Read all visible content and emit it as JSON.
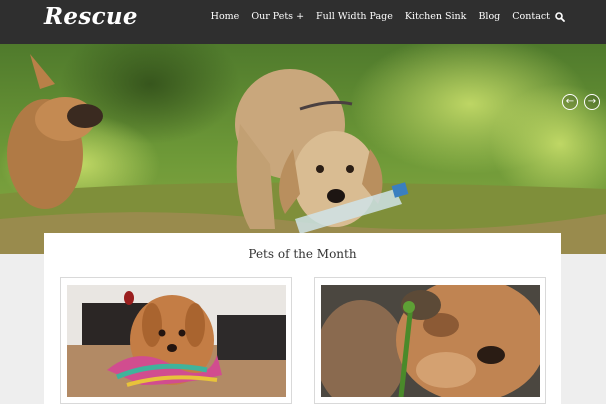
{
  "header": {
    "logo": "Rescue",
    "nav": [
      {
        "label": "Home"
      },
      {
        "label": "Our Pets +"
      },
      {
        "label": "Full Width Page"
      },
      {
        "label": "Kitchen Sink"
      },
      {
        "label": "Blog"
      },
      {
        "label": "Contact"
      }
    ],
    "search_icon": "search-icon"
  },
  "hero": {
    "slider_prev_icon": "arrow-left-circle-icon",
    "slider_next_icon": "arrow-right-circle-icon"
  },
  "section": {
    "title": "Pets of the Month"
  },
  "colors": {
    "header_bg": "#2f2f2f",
    "page_bg": "#eeeeee",
    "card_bg": "#ffffff"
  }
}
